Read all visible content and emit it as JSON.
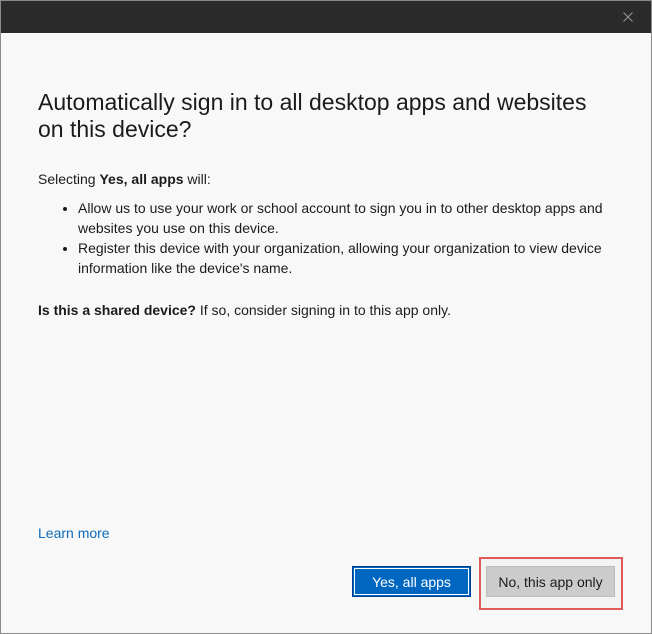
{
  "dialog": {
    "heading": "Automatically sign in to all desktop apps and websites on this device?",
    "intro_prefix": "Selecting ",
    "intro_bold": "Yes, all apps",
    "intro_suffix": " will:",
    "bullets": [
      "Allow us to use your work or school account to sign you in to other desktop apps and websites you use on this device.",
      "Register this device with your organization, allowing your organization to view device information like the device's name."
    ],
    "shared_bold": "Is this a shared device?",
    "shared_rest": " If so, consider signing in to this app only.",
    "learn_more": "Learn more"
  },
  "buttons": {
    "yes_label": "Yes, all apps",
    "no_label": "No, this app only"
  },
  "colors": {
    "titlebar": "#2b2b2b",
    "link": "#0f6cbd",
    "primary": "#0067c0",
    "highlight": "#e05a5a"
  },
  "icons": {
    "close": "close-icon"
  }
}
